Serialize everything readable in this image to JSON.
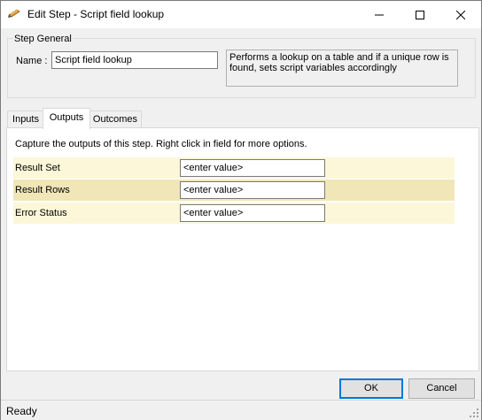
{
  "window": {
    "title": "Edit Step - Script field lookup",
    "title_icon": "wrench-pencil-icon",
    "controls": {
      "minimize": "minimize-icon",
      "maximize": "maximize-icon",
      "close": "close-icon"
    }
  },
  "step_general": {
    "group_label": "Step General",
    "name_label": "Name :",
    "name_value": "Script field lookup",
    "description": "Performs a lookup on a table and if a unique row is found, sets script variables accordingly"
  },
  "tabs": [
    {
      "label": "Inputs",
      "active": false
    },
    {
      "label": "Outputs",
      "active": true
    },
    {
      "label": "Outcomes",
      "active": false
    }
  ],
  "outputs": {
    "caption": "Capture the outputs of this step.  Right click in field for more options.",
    "rows": [
      {
        "label": "Result Set",
        "value": "<enter value>"
      },
      {
        "label": "Result Rows",
        "value": "<enter value>"
      },
      {
        "label": "Error Status",
        "value": "<enter value>"
      }
    ],
    "row_colors": [
      "#fbf7d8",
      "#f0e6b8",
      "#fbf7d8"
    ]
  },
  "buttons": {
    "ok": "OK",
    "cancel": "Cancel"
  },
  "status": {
    "text": "Ready"
  },
  "colors": {
    "accent": "#0078d7"
  }
}
